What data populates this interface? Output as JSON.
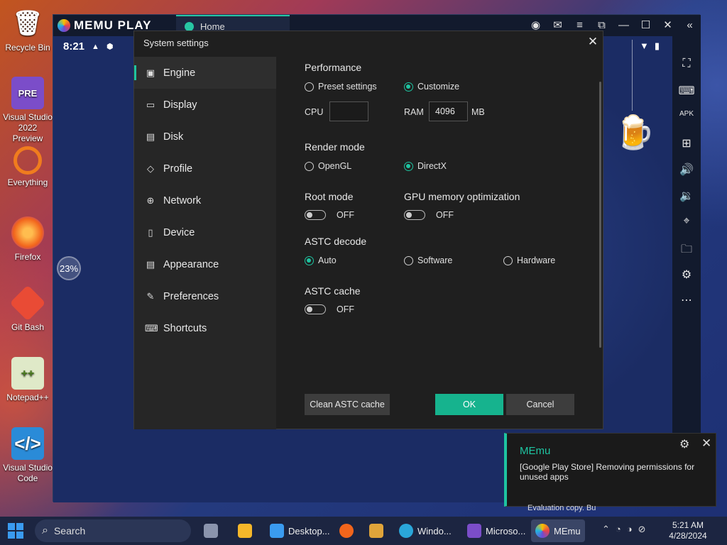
{
  "desktop": {
    "icons": [
      {
        "label": "Recycle Bin",
        "icon": "recycle-bin-icon",
        "color": "#4a90d9"
      },
      {
        "label": "Visual Studio 2022 Preview",
        "icon": "visual-studio-preview-icon",
        "color": "#7b4dc9",
        "badge": "PRE"
      },
      {
        "label": "Everything",
        "icon": "everything-search-icon",
        "color": "#f07c1e"
      },
      {
        "label": "Firefox",
        "icon": "firefox-icon",
        "color": "#f2651c"
      },
      {
        "label": "Git Bash",
        "icon": "git-bash-icon",
        "color": "#e94b35"
      },
      {
        "label": "Notepad++",
        "icon": "notepad-plus-plus-icon",
        "color": "#8bc34a"
      },
      {
        "label": "Visual Studio Code",
        "icon": "vscode-icon",
        "color": "#2a8bd8"
      }
    ],
    "eval_text": "Evaluation copy. Bu"
  },
  "emulator": {
    "brand": "MEMU PLAY",
    "tab_label": "Home",
    "status_time": "8:21",
    "progress_badge": "23%"
  },
  "dialog": {
    "title": "System settings",
    "nav": [
      {
        "label": "Engine",
        "icon": "chip-icon",
        "active": true
      },
      {
        "label": "Display",
        "icon": "monitor-icon"
      },
      {
        "label": "Disk",
        "icon": "disk-icon"
      },
      {
        "label": "Profile",
        "icon": "tag-icon"
      },
      {
        "label": "Network",
        "icon": "globe-icon"
      },
      {
        "label": "Device",
        "icon": "phone-icon"
      },
      {
        "label": "Appearance",
        "icon": "window-icon"
      },
      {
        "label": "Preferences",
        "icon": "wrench-icon"
      },
      {
        "label": "Shortcuts",
        "icon": "keyboard-icon"
      }
    ],
    "performance": {
      "title": "Performance",
      "preset_label": "Preset settings",
      "customize_label": "Customize",
      "selected": "Customize",
      "cpu_label": "CPU",
      "cpu_value": "",
      "ram_label": "RAM",
      "ram_value": "4096",
      "ram_unit": "MB"
    },
    "render": {
      "title": "Render mode",
      "opengl_label": "OpenGL",
      "directx_label": "DirectX",
      "selected": "DirectX"
    },
    "root": {
      "title": "Root mode",
      "state": "OFF"
    },
    "gpu": {
      "title": "GPU memory optimization",
      "state": "OFF"
    },
    "astc_decode": {
      "title": "ASTC decode",
      "auto_label": "Auto",
      "software_label": "Software",
      "hardware_label": "Hardware",
      "selected": "Auto"
    },
    "astc_cache": {
      "title": "ASTC cache",
      "state": "OFF"
    },
    "buttons": {
      "clean": "Clean ASTC cache",
      "ok": "OK",
      "cancel": "Cancel"
    }
  },
  "toast": {
    "title": "MEmu",
    "message": "[Google Play Store] Removing permissions for unused apps"
  },
  "taskbar": {
    "search_placeholder": "Search",
    "apps": [
      {
        "label": "Desktop...",
        "icon": "desktop-app-icon",
        "color": "#3a9bf0"
      },
      {
        "label": "Windo...",
        "icon": "edge-icon",
        "color": "#2aa6d9"
      },
      {
        "label": "Microso...",
        "icon": "visual-studio-icon",
        "color": "#7b4dc9"
      },
      {
        "label": "MEmu",
        "icon": "memu-icon",
        "color": "#6a4cd6",
        "active": true
      }
    ],
    "clock_time": "5:21 AM",
    "clock_date": "4/28/2024"
  },
  "colors": {
    "accent": "#1ec4a1",
    "ok_button": "#16b38e"
  }
}
